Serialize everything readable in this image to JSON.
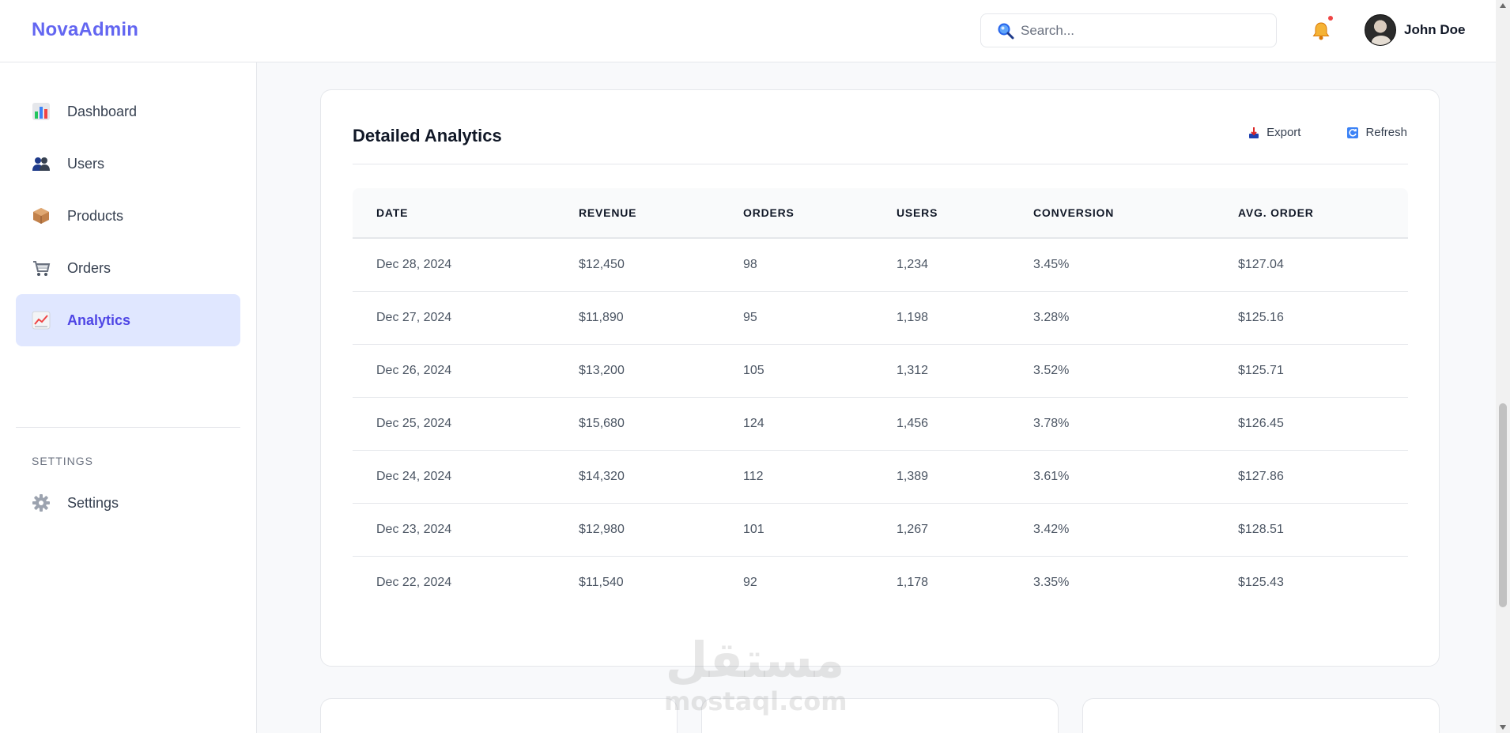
{
  "app": {
    "brand": "NovaAdmin"
  },
  "header": {
    "search_placeholder": "Search...",
    "user_name": "John Doe",
    "notification_color": "#ef4444"
  },
  "sidebar": {
    "items": [
      {
        "label": "Dashboard",
        "icon": "bar-chart-icon"
      },
      {
        "label": "Users",
        "icon": "users-icon"
      },
      {
        "label": "Products",
        "icon": "package-icon"
      },
      {
        "label": "Orders",
        "icon": "cart-icon"
      },
      {
        "label": "Analytics",
        "icon": "trend-chart-icon",
        "active": true
      }
    ],
    "section_label": "SETTINGS",
    "settings_item": {
      "label": "Settings",
      "icon": "gear-icon"
    }
  },
  "analytics": {
    "title": "Detailed Analytics",
    "export_label": "Export",
    "refresh_label": "Refresh",
    "columns": [
      "DATE",
      "REVENUE",
      "ORDERS",
      "USERS",
      "CONVERSION",
      "AVG. ORDER"
    ],
    "rows": [
      [
        "Dec 28, 2024",
        "$12,450",
        "98",
        "1,234",
        "3.45%",
        "$127.04"
      ],
      [
        "Dec 27, 2024",
        "$11,890",
        "95",
        "1,198",
        "3.28%",
        "$125.16"
      ],
      [
        "Dec 26, 2024",
        "$13,200",
        "105",
        "1,312",
        "3.52%",
        "$125.71"
      ],
      [
        "Dec 25, 2024",
        "$15,680",
        "124",
        "1,456",
        "3.78%",
        "$126.45"
      ],
      [
        "Dec 24, 2024",
        "$14,320",
        "112",
        "1,389",
        "3.61%",
        "$127.86"
      ],
      [
        "Dec 23, 2024",
        "$12,980",
        "101",
        "1,267",
        "3.42%",
        "$128.51"
      ],
      [
        "Dec 22, 2024",
        "$11,540",
        "92",
        "1,178",
        "3.35%",
        "$125.43"
      ]
    ]
  },
  "watermark": {
    "arabic": "مستقل",
    "latin": "mostaql.com"
  },
  "colors": {
    "accent": "#6366f1",
    "active_bg": "#e0e7ff",
    "active_text": "#4f46e5"
  }
}
